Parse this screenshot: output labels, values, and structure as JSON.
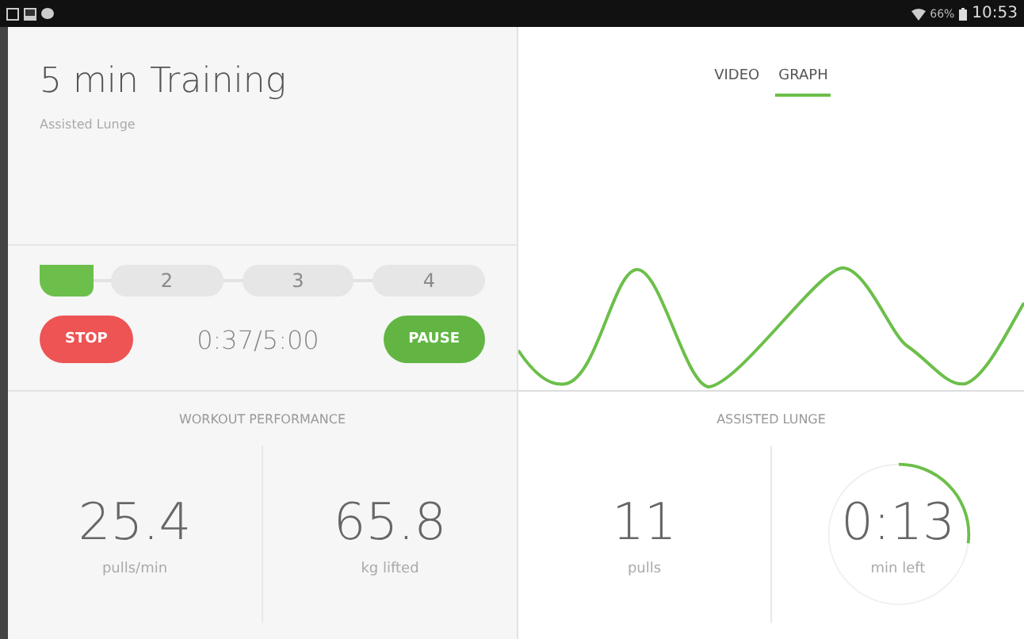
{
  "status_bar": {
    "battery": "66%",
    "time": "10:53"
  },
  "training": {
    "title": "5 min Training",
    "subtitle": "Assisted Lunge"
  },
  "progress": {
    "level": 0.12,
    "segments": [
      "2",
      "3",
      "4"
    ],
    "time": "0:37/5:00"
  },
  "buttons": [
    {
      "label": "STOP",
      "kind": "stop"
    },
    {
      "label": "PAUSE",
      "kind": "pause"
    }
  ],
  "tabs": [
    {
      "label": "VIDEO",
      "selected": false
    },
    {
      "label": "GRAPH",
      "selected": true
    }
  ],
  "workout_performance": {
    "title": "WORKOUT PERFORMANCE",
    "stats": [
      {
        "value": "25.4",
        "unit": "pulls/min"
      },
      {
        "value": "65.8",
        "unit": "kg lifted"
      }
    ]
  },
  "assisted_lunge": {
    "title": "ASSISTED LUNGE",
    "stats": [
      {
        "value": "11",
        "unit": "pulls",
        "kind": "plain"
      },
      {
        "value": "0:13",
        "unit": "min left",
        "kind": "ring"
      }
    ]
  }
}
